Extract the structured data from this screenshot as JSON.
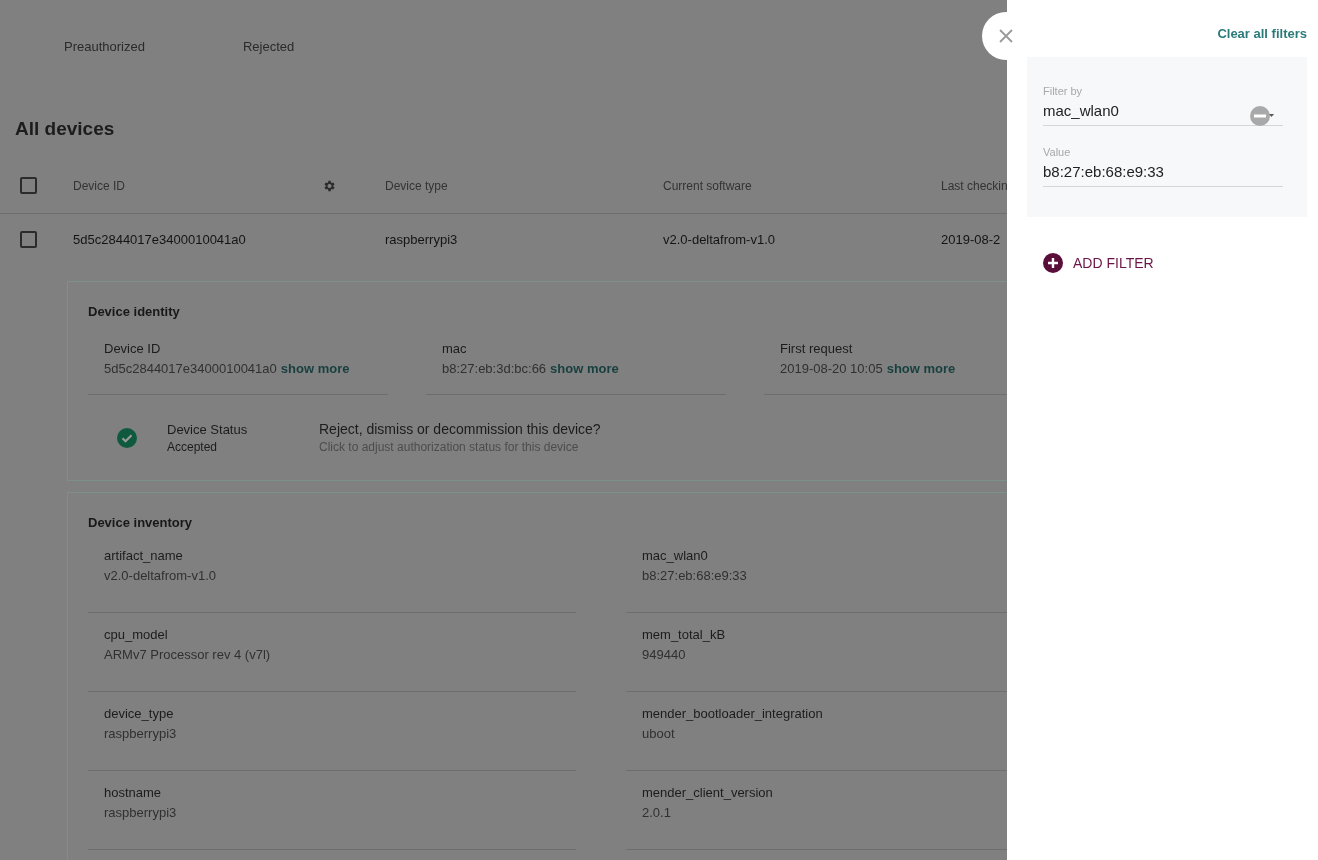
{
  "tabs": [
    {
      "label": "Preauthorized",
      "selected": false
    },
    {
      "label": "Rejected",
      "selected": false
    }
  ],
  "title": "All devices",
  "table": {
    "select_all": {
      "checked": false
    },
    "columns": [
      "Device ID",
      "Device type",
      "Current software",
      "Last checkin"
    ],
    "rows": [
      {
        "checked": false,
        "cells": [
          "5d5c2844017e3400010041a0",
          "raspberrypi3",
          "v2.0-deltafrom-v1.0",
          "2019-08-2"
        ]
      }
    ]
  },
  "identity": {
    "title": "Device identity",
    "fields": [
      {
        "label": "Device ID",
        "value": "5d5c2844017e3400010041a0",
        "link": "show more"
      },
      {
        "label": "mac",
        "value": "b8:27:eb:3d:bc:66",
        "link": "show more"
      },
      {
        "label": "First request",
        "value": "2019-08-20 10:05",
        "link": "show more"
      }
    ],
    "status": {
      "label": "Device Status",
      "value": "Accepted",
      "accepted": true
    },
    "action": {
      "title": "Reject, dismiss or decommission this device?",
      "hint": "Click to adjust authorization status for this device"
    }
  },
  "inventory": {
    "title": "Device inventory",
    "fields": [
      {
        "label": "artifact_name",
        "value": "v2.0-deltafrom-v1.0"
      },
      {
        "label": "mac_wlan0",
        "value": "b8:27:eb:68:e9:33"
      },
      {
        "label": "cpu_model",
        "value": "ARMv7 Processor rev 4 (v7l)"
      },
      {
        "label": "mem_total_kB",
        "value": "949440"
      },
      {
        "label": "device_type",
        "value": "raspberrypi3"
      },
      {
        "label": "mender_bootloader_integration",
        "value": "uboot"
      },
      {
        "label": "hostname",
        "value": "raspberrypi3"
      },
      {
        "label": "mender_client_version",
        "value": "2.0.1"
      }
    ]
  },
  "drawer": {
    "clear": "Clear all filters",
    "filters": [
      {
        "filter_by": {
          "label": "Filter by",
          "value": "mac_wlan0"
        },
        "value": {
          "label": "Value",
          "value": "b8:27:eb:68:e9:33"
        }
      }
    ],
    "add": "ADD FILTER"
  }
}
